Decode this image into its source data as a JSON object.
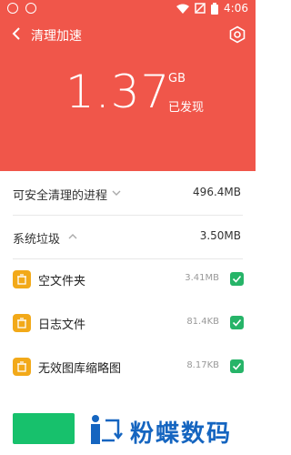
{
  "status_bar": {
    "time": "4:06"
  },
  "header": {
    "title": "清理加速",
    "size_value": "1.37",
    "size_unit": "GB",
    "found_label": "已发现",
    "bg_color": "#f0564a"
  },
  "sections": [
    {
      "label": "可安全清理的进程",
      "value": "496.4MB",
      "expanded": false
    },
    {
      "label": "系统垃圾",
      "value": "3.50MB",
      "expanded": true
    }
  ],
  "junk_items": [
    {
      "name": "空文件夹",
      "size": "3.41MB",
      "checked": true
    },
    {
      "name": "日志文件",
      "size": "81.4KB",
      "checked": true
    },
    {
      "name": "无效图库缩略图",
      "size": "8.17KB",
      "checked": true
    }
  ],
  "watermark": {
    "text": "粉蝶数码"
  },
  "colors": {
    "accent_green": "#17c16c",
    "folder_icon": "#f2a919",
    "checkbox": "#26b468"
  }
}
